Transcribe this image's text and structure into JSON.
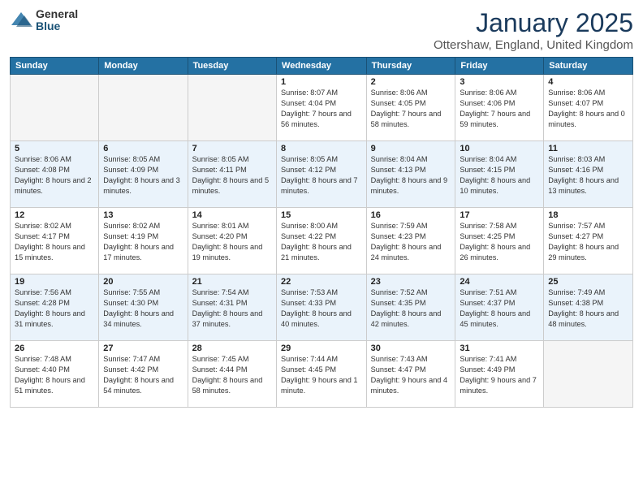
{
  "logo": {
    "general": "General",
    "blue": "Blue"
  },
  "title": "January 2025",
  "location": "Ottershaw, England, United Kingdom",
  "days_of_week": [
    "Sunday",
    "Monday",
    "Tuesday",
    "Wednesday",
    "Thursday",
    "Friday",
    "Saturday"
  ],
  "weeks": [
    [
      {
        "day": "",
        "info": ""
      },
      {
        "day": "",
        "info": ""
      },
      {
        "day": "",
        "info": ""
      },
      {
        "day": "1",
        "info": "Sunrise: 8:07 AM\nSunset: 4:04 PM\nDaylight: 7 hours and 56 minutes."
      },
      {
        "day": "2",
        "info": "Sunrise: 8:06 AM\nSunset: 4:05 PM\nDaylight: 7 hours and 58 minutes."
      },
      {
        "day": "3",
        "info": "Sunrise: 8:06 AM\nSunset: 4:06 PM\nDaylight: 7 hours and 59 minutes."
      },
      {
        "day": "4",
        "info": "Sunrise: 8:06 AM\nSunset: 4:07 PM\nDaylight: 8 hours and 0 minutes."
      }
    ],
    [
      {
        "day": "5",
        "info": "Sunrise: 8:06 AM\nSunset: 4:08 PM\nDaylight: 8 hours and 2 minutes."
      },
      {
        "day": "6",
        "info": "Sunrise: 8:05 AM\nSunset: 4:09 PM\nDaylight: 8 hours and 3 minutes."
      },
      {
        "day": "7",
        "info": "Sunrise: 8:05 AM\nSunset: 4:11 PM\nDaylight: 8 hours and 5 minutes."
      },
      {
        "day": "8",
        "info": "Sunrise: 8:05 AM\nSunset: 4:12 PM\nDaylight: 8 hours and 7 minutes."
      },
      {
        "day": "9",
        "info": "Sunrise: 8:04 AM\nSunset: 4:13 PM\nDaylight: 8 hours and 9 minutes."
      },
      {
        "day": "10",
        "info": "Sunrise: 8:04 AM\nSunset: 4:15 PM\nDaylight: 8 hours and 10 minutes."
      },
      {
        "day": "11",
        "info": "Sunrise: 8:03 AM\nSunset: 4:16 PM\nDaylight: 8 hours and 13 minutes."
      }
    ],
    [
      {
        "day": "12",
        "info": "Sunrise: 8:02 AM\nSunset: 4:17 PM\nDaylight: 8 hours and 15 minutes."
      },
      {
        "day": "13",
        "info": "Sunrise: 8:02 AM\nSunset: 4:19 PM\nDaylight: 8 hours and 17 minutes."
      },
      {
        "day": "14",
        "info": "Sunrise: 8:01 AM\nSunset: 4:20 PM\nDaylight: 8 hours and 19 minutes."
      },
      {
        "day": "15",
        "info": "Sunrise: 8:00 AM\nSunset: 4:22 PM\nDaylight: 8 hours and 21 minutes."
      },
      {
        "day": "16",
        "info": "Sunrise: 7:59 AM\nSunset: 4:23 PM\nDaylight: 8 hours and 24 minutes."
      },
      {
        "day": "17",
        "info": "Sunrise: 7:58 AM\nSunset: 4:25 PM\nDaylight: 8 hours and 26 minutes."
      },
      {
        "day": "18",
        "info": "Sunrise: 7:57 AM\nSunset: 4:27 PM\nDaylight: 8 hours and 29 minutes."
      }
    ],
    [
      {
        "day": "19",
        "info": "Sunrise: 7:56 AM\nSunset: 4:28 PM\nDaylight: 8 hours and 31 minutes."
      },
      {
        "day": "20",
        "info": "Sunrise: 7:55 AM\nSunset: 4:30 PM\nDaylight: 8 hours and 34 minutes."
      },
      {
        "day": "21",
        "info": "Sunrise: 7:54 AM\nSunset: 4:31 PM\nDaylight: 8 hours and 37 minutes."
      },
      {
        "day": "22",
        "info": "Sunrise: 7:53 AM\nSunset: 4:33 PM\nDaylight: 8 hours and 40 minutes."
      },
      {
        "day": "23",
        "info": "Sunrise: 7:52 AM\nSunset: 4:35 PM\nDaylight: 8 hours and 42 minutes."
      },
      {
        "day": "24",
        "info": "Sunrise: 7:51 AM\nSunset: 4:37 PM\nDaylight: 8 hours and 45 minutes."
      },
      {
        "day": "25",
        "info": "Sunrise: 7:49 AM\nSunset: 4:38 PM\nDaylight: 8 hours and 48 minutes."
      }
    ],
    [
      {
        "day": "26",
        "info": "Sunrise: 7:48 AM\nSunset: 4:40 PM\nDaylight: 8 hours and 51 minutes."
      },
      {
        "day": "27",
        "info": "Sunrise: 7:47 AM\nSunset: 4:42 PM\nDaylight: 8 hours and 54 minutes."
      },
      {
        "day": "28",
        "info": "Sunrise: 7:45 AM\nSunset: 4:44 PM\nDaylight: 8 hours and 58 minutes."
      },
      {
        "day": "29",
        "info": "Sunrise: 7:44 AM\nSunset: 4:45 PM\nDaylight: 9 hours and 1 minute."
      },
      {
        "day": "30",
        "info": "Sunrise: 7:43 AM\nSunset: 4:47 PM\nDaylight: 9 hours and 4 minutes."
      },
      {
        "day": "31",
        "info": "Sunrise: 7:41 AM\nSunset: 4:49 PM\nDaylight: 9 hours and 7 minutes."
      },
      {
        "day": "",
        "info": ""
      }
    ]
  ]
}
